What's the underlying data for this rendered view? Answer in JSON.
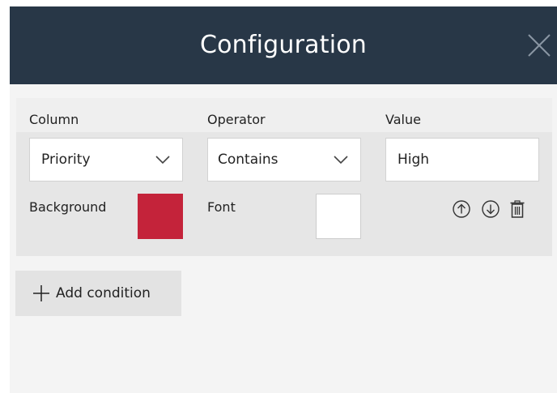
{
  "dialog": {
    "title": "Configuration",
    "close_icon": "close-icon"
  },
  "condition": {
    "column": {
      "label": "Column",
      "value": "Priority",
      "icon": "chevron-down-icon"
    },
    "operator": {
      "label": "Operator",
      "value": "Contains",
      "icon": "chevron-down-icon"
    },
    "value": {
      "label": "Value",
      "value": "High"
    },
    "background": {
      "label": "Background",
      "color": "#c4233a"
    },
    "font": {
      "label": "Font",
      "color": "#ffffff"
    },
    "actions": [
      "move-up-icon",
      "move-down-icon",
      "delete-icon"
    ]
  },
  "add_condition": {
    "label": "Add condition",
    "icon": "plus-icon"
  },
  "colors": {
    "header_bg": "#283747",
    "panel_bg": "#e6e6e6",
    "window_bg": "#f4f4f4",
    "button_bg": "#e3e3e3"
  }
}
